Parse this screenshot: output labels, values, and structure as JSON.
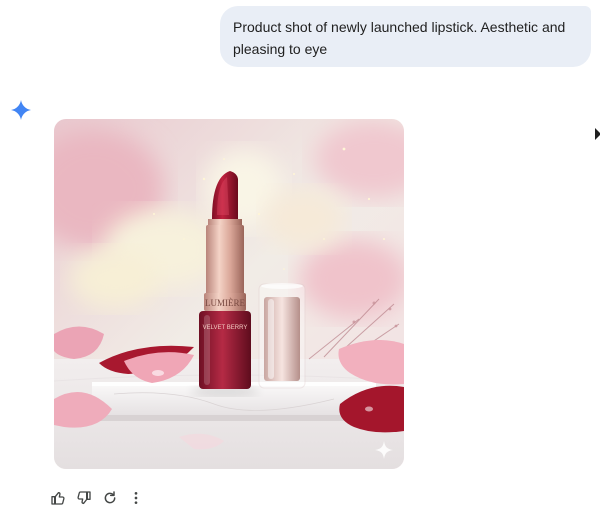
{
  "chat": {
    "user_prompt": "Product shot of newly launched lipstick. Aesthetic and pleasing to eye",
    "assistant_avatar_icon": "gemini-sparkle-icon",
    "accent_color": "#4285f4"
  },
  "generated_image": {
    "brand_text": "LUMIÈRE",
    "shade_text": "VELVET BERRY",
    "watermark_icon": "sparkle-watermark-icon"
  },
  "actions": [
    {
      "icon": "thumbs-up-icon"
    },
    {
      "icon": "thumbs-down-icon"
    },
    {
      "icon": "regenerate-icon"
    },
    {
      "icon": "more-vert-icon"
    }
  ]
}
